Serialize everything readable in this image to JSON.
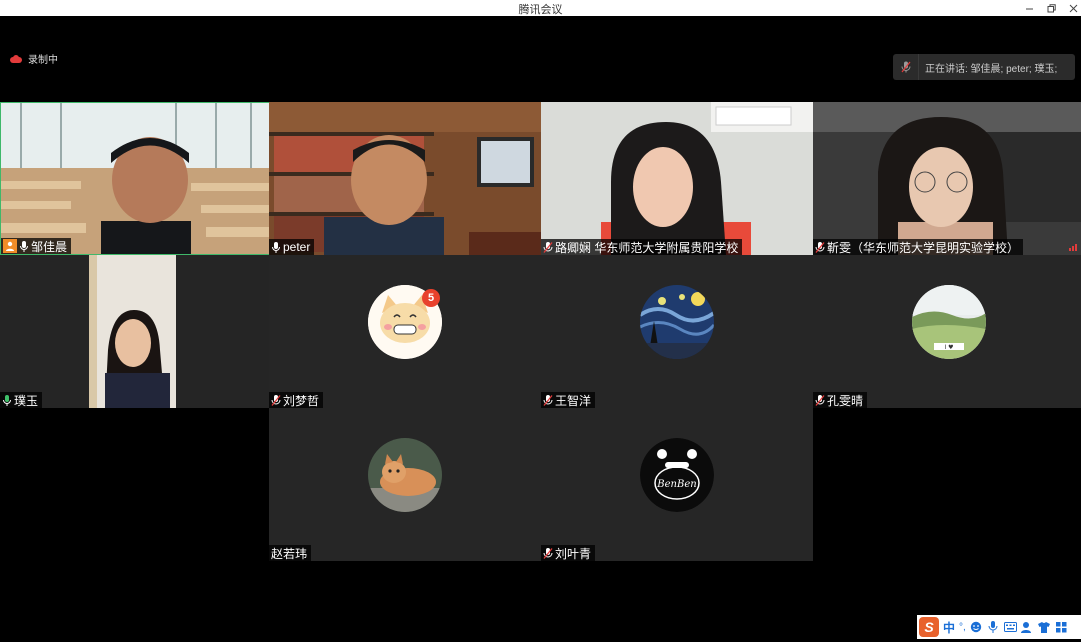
{
  "window": {
    "title": "腾讯会议",
    "min_icon": "minimize-icon",
    "max_icon": "restore-icon",
    "close_icon": "close-icon"
  },
  "recording": {
    "label": "录制中",
    "icon": "cloud-record-icon",
    "color": "#e23b3b"
  },
  "speaking": {
    "label": "正在讲话: 邹佳晨; peter; 璞玉;"
  },
  "participants": [
    {
      "name": "邹佳晨",
      "video": true,
      "host_icon": true,
      "mic": "on"
    },
    {
      "name": "peter",
      "video": true,
      "mic": "on"
    },
    {
      "name": "路卿娴 华东师范大学附属贵阳学校",
      "video": true,
      "mic": "muted"
    },
    {
      "name": "靳雯（华东师范大学昆明实验学校）",
      "video": true,
      "mic": "muted",
      "signal": "weak"
    },
    {
      "name": "璞玉",
      "video": true,
      "mic": "speaking"
    },
    {
      "name": "刘梦哲",
      "video": false,
      "mic": "muted",
      "avatar": "cat-cartoon-avatar",
      "badge": "5"
    },
    {
      "name": "王智洋",
      "video": false,
      "mic": "muted",
      "avatar": "starry-night-avatar"
    },
    {
      "name": "孔雯晴",
      "video": false,
      "mic": "muted",
      "avatar": "landscape-avatar"
    },
    {
      "name": "赵若玮",
      "video": false,
      "mic": "none",
      "avatar": "cat-photo-avatar"
    },
    {
      "name": "刘叶青",
      "video": false,
      "mic": "muted",
      "avatar": "benben-avatar",
      "avatar_text": "BenBen"
    }
  ],
  "ime": {
    "logo": "S",
    "mode": "中",
    "punct": "°,",
    "items": [
      "emoji-icon",
      "voice-icon",
      "keyboard-icon",
      "user-icon",
      "shirt-icon",
      "grid-icon"
    ]
  }
}
